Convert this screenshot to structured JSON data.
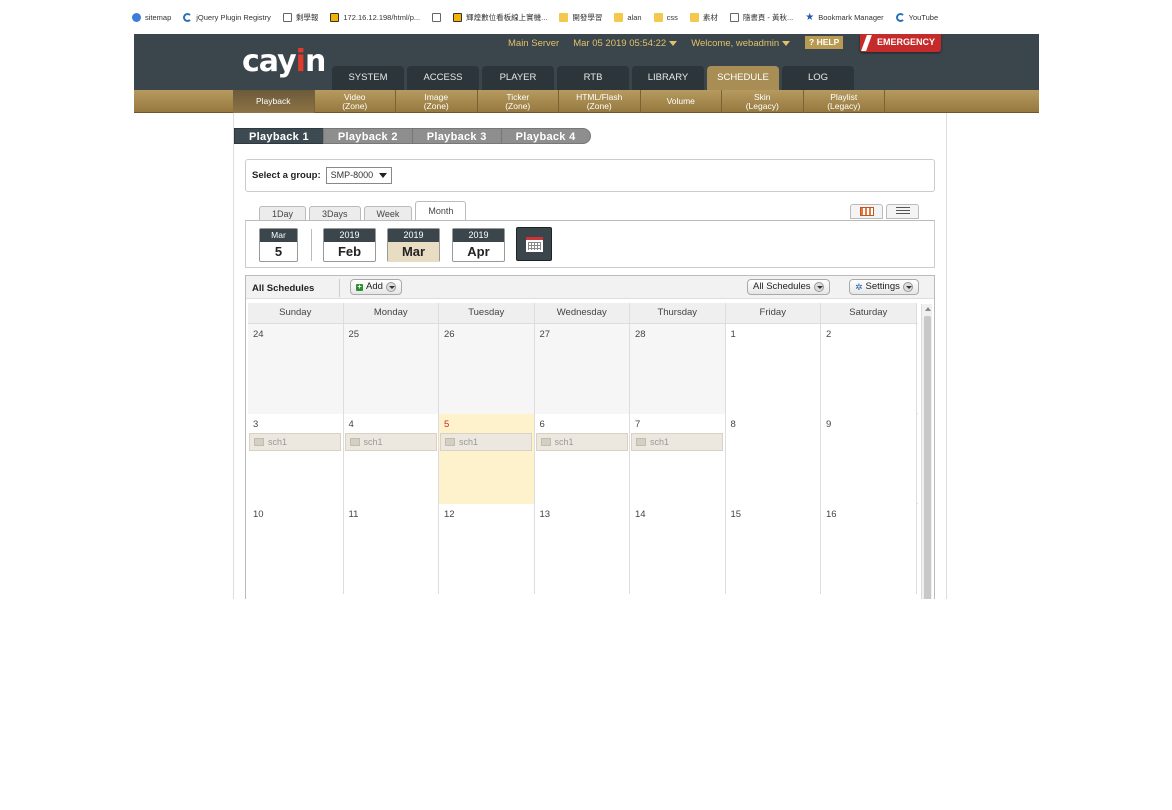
{
  "bookmarks": [
    {
      "label": "sitemap",
      "icon": "globe-icon"
    },
    {
      "label": "jQuery Plugin Registry",
      "icon": "jquery-icon"
    },
    {
      "label": "剩學報",
      "icon": "page-icon"
    },
    {
      "label": "172.16.12.198/html/p...",
      "icon": "cayin-icon"
    },
    {
      "label": "",
      "icon": "page-icon"
    },
    {
      "label": "輝煌數位看板線上實機...",
      "icon": "cayin-icon"
    },
    {
      "label": "開發學習",
      "icon": "folder-icon"
    },
    {
      "label": "alan",
      "icon": "folder-icon"
    },
    {
      "label": "css",
      "icon": "folder-icon"
    },
    {
      "label": "素材",
      "icon": "folder-icon"
    },
    {
      "label": "隨書頁 - 黃秋...",
      "icon": "page-icon"
    },
    {
      "label": "Bookmark Manager",
      "icon": "star-icon"
    },
    {
      "label": "YouTube",
      "icon": "youtube-icon"
    }
  ],
  "header": {
    "server": "Main Server",
    "datetime": "Mar 05 2019 05:54:22",
    "welcome": "Welcome, webadmin",
    "help": "HELP",
    "emergency": "EMERGENCY"
  },
  "main_tabs": [
    "SYSTEM",
    "ACCESS",
    "PLAYER",
    "RTB",
    "LIBRARY",
    "SCHEDULE",
    "LOG"
  ],
  "sub_tabs": [
    {
      "line1": "Playback",
      "line2": ""
    },
    {
      "line1": "Video",
      "line2": "(Zone)"
    },
    {
      "line1": "Image",
      "line2": "(Zone)"
    },
    {
      "line1": "Ticker",
      "line2": "(Zone)"
    },
    {
      "line1": "HTML/Flash",
      "line2": "(Zone)"
    },
    {
      "line1": "Volume",
      "line2": ""
    },
    {
      "line1": "Skin",
      "line2": "(Legacy)"
    },
    {
      "line1": "Playlist",
      "line2": "(Legacy)"
    }
  ],
  "playback_tabs": [
    "Playback 1",
    "Playback 2",
    "Playback 3",
    "Playback 4"
  ],
  "group": {
    "label": "Select a group:",
    "value": "SMP-8000"
  },
  "view_tabs": [
    "1Day",
    "3Days",
    "Week",
    "Month"
  ],
  "date_nav": {
    "day": {
      "month": "Mar",
      "day": "5"
    },
    "months": [
      {
        "year": "2019",
        "month": "Feb"
      },
      {
        "year": "2019",
        "month": "Mar"
      },
      {
        "year": "2019",
        "month": "Apr"
      }
    ]
  },
  "schedule": {
    "title": "All Schedules",
    "add": "Add",
    "filter": "All Schedules",
    "settings": "Settings"
  },
  "calendar": {
    "days_of_week": [
      "Sunday",
      "Monday",
      "Tuesday",
      "Wednesday",
      "Thursday",
      "Friday",
      "Saturday"
    ],
    "weeks": [
      [
        {
          "d": "24",
          "other": true
        },
        {
          "d": "25",
          "other": true
        },
        {
          "d": "26",
          "other": true
        },
        {
          "d": "27",
          "other": true
        },
        {
          "d": "28",
          "other": true
        },
        {
          "d": "1"
        },
        {
          "d": "2"
        }
      ],
      [
        {
          "d": "3",
          "ev": "sch1"
        },
        {
          "d": "4",
          "ev": "sch1"
        },
        {
          "d": "5",
          "ev": "sch1",
          "today": true
        },
        {
          "d": "6",
          "ev": "sch1"
        },
        {
          "d": "7",
          "ev": "sch1"
        },
        {
          "d": "8"
        },
        {
          "d": "9"
        }
      ],
      [
        {
          "d": "10"
        },
        {
          "d": "11"
        },
        {
          "d": "12"
        },
        {
          "d": "13"
        },
        {
          "d": "14"
        },
        {
          "d": "15"
        },
        {
          "d": "16"
        }
      ]
    ]
  }
}
